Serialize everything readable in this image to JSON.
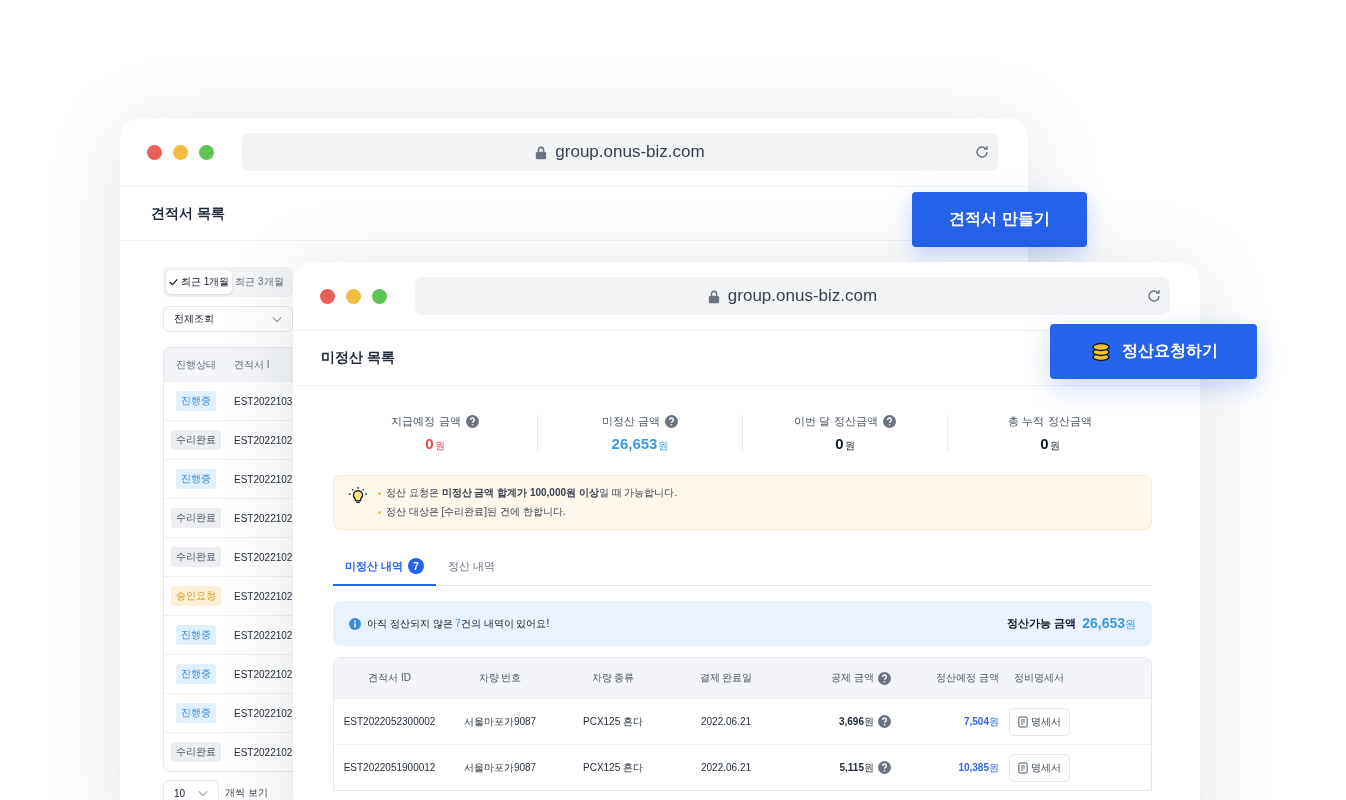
{
  "back_window": {
    "url": "group.onus-biz.com",
    "title": "견적서 목록",
    "period_tabs": [
      {
        "label": "최근 1개월",
        "selected": true
      },
      {
        "label": "최근 3개월",
        "selected": false
      }
    ],
    "filter": {
      "value": "전체조회"
    },
    "table": {
      "columns": [
        "진행상태",
        "견적서 I"
      ],
      "rows": [
        {
          "status": "진행중",
          "kind": "progress",
          "id": "EST2022103"
        },
        {
          "status": "수리완료",
          "kind": "done",
          "id": "EST2022102"
        },
        {
          "status": "진행중",
          "kind": "progress",
          "id": "EST2022102"
        },
        {
          "status": "수리완료",
          "kind": "done",
          "id": "EST2022102"
        },
        {
          "status": "수리완료",
          "kind": "done",
          "id": "EST2022102"
        },
        {
          "status": "승인요청",
          "kind": "approval",
          "id": "EST2022102"
        },
        {
          "status": "진행중",
          "kind": "progress",
          "id": "EST2022102"
        },
        {
          "status": "진행중",
          "kind": "progress",
          "id": "EST2022102"
        },
        {
          "status": "진행중",
          "kind": "progress",
          "id": "EST2022102"
        },
        {
          "status": "수리완료",
          "kind": "done",
          "id": "EST2022102"
        }
      ]
    },
    "page_size": {
      "value": "10",
      "label": "개씩 보기"
    }
  },
  "create_button": "견적서 만들기",
  "front_window": {
    "url": "group.onus-biz.com",
    "title": "미정산 목록",
    "stats": [
      {
        "label": "지급예정 금액",
        "help": true,
        "value": "0",
        "unit": "원",
        "kind": "negative"
      },
      {
        "label": "미정산 금액",
        "help": true,
        "value": "26,653",
        "unit": "원",
        "kind": "highlight"
      },
      {
        "label": "이번 달 정산금액",
        "help": true,
        "value": "0",
        "unit": "원",
        "kind": "plain"
      },
      {
        "label": "총 누적 정산금액",
        "help": false,
        "value": "0",
        "unit": "원",
        "kind": "plain"
      }
    ],
    "notices": [
      "정산 요청은 **미정산 금액 합계가 100,000원 이상**일 때 가능합니다.",
      "정산 대상은 [수리완료]된 건에 한합니다."
    ],
    "tabs": [
      {
        "label": "미정산 내역",
        "count": "7",
        "selected": true
      },
      {
        "label": "정산 내역",
        "selected": false
      }
    ],
    "info": {
      "message_before": "아직 정산되지 않은 ",
      "message_count": "7",
      "message_after": "건의 내역이 있어요!",
      "amount_label": "정산가능 금액",
      "amount": "26,653",
      "amount_unit": "원"
    },
    "table": {
      "columns": [
        {
          "label": "견적서 ID",
          "help": false
        },
        {
          "label": "차량 번호",
          "help": false
        },
        {
          "label": "차량 종류",
          "help": false
        },
        {
          "label": "결제 완료일",
          "help": false
        },
        {
          "label": "공제 금액",
          "help": true
        },
        {
          "label": "정산예정 금액",
          "help": false
        },
        {
          "label": "정비명세서",
          "help": false
        }
      ],
      "rows": [
        {
          "id": "EST2022052300002",
          "plate": "서울마포가9087",
          "vehicle": "PCX125 혼다",
          "date": "2022.06.21",
          "deduction": "3,696",
          "deduction_unit": "원",
          "amount": "7,504",
          "amount_unit": "원",
          "receipt": "명세서"
        },
        {
          "id": "EST2022051900012",
          "plate": "서울마포가9087",
          "vehicle": "PCX125 혼다",
          "date": "2022.06.21",
          "deduction": "5,115",
          "deduction_unit": "원",
          "amount": "10,385",
          "amount_unit": "원",
          "receipt": "명세서"
        }
      ]
    }
  },
  "settle_button": "정산요청하기"
}
